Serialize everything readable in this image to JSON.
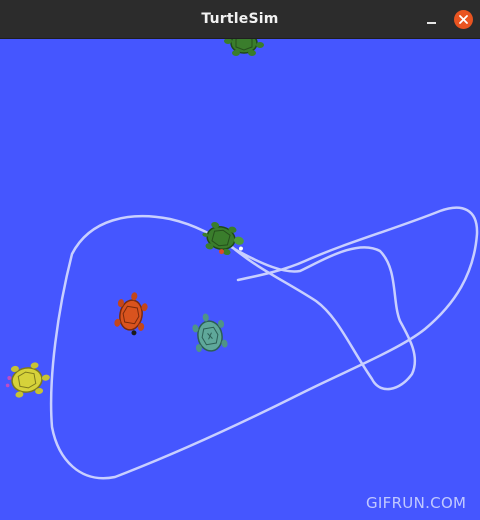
{
  "window": {
    "title": "TurtleSim",
    "background_color": "#4556ff",
    "trail_color": "#c8cfff"
  },
  "controls": {
    "minimize_icon": "minimize-icon",
    "close_icon": "close-icon",
    "close_color": "#e95420"
  },
  "turtles": [
    {
      "name": "turtle-green-top",
      "color": "#3a7d2c"
    },
    {
      "name": "turtle-green-moving",
      "color": "#3a7d2c"
    },
    {
      "name": "turtle-orange",
      "color": "#d9531e"
    },
    {
      "name": "turtle-teal",
      "color": "#5fa89a"
    },
    {
      "name": "turtle-yellow",
      "color": "#d6d23a"
    }
  ],
  "watermark": "GIFRUN.COM"
}
